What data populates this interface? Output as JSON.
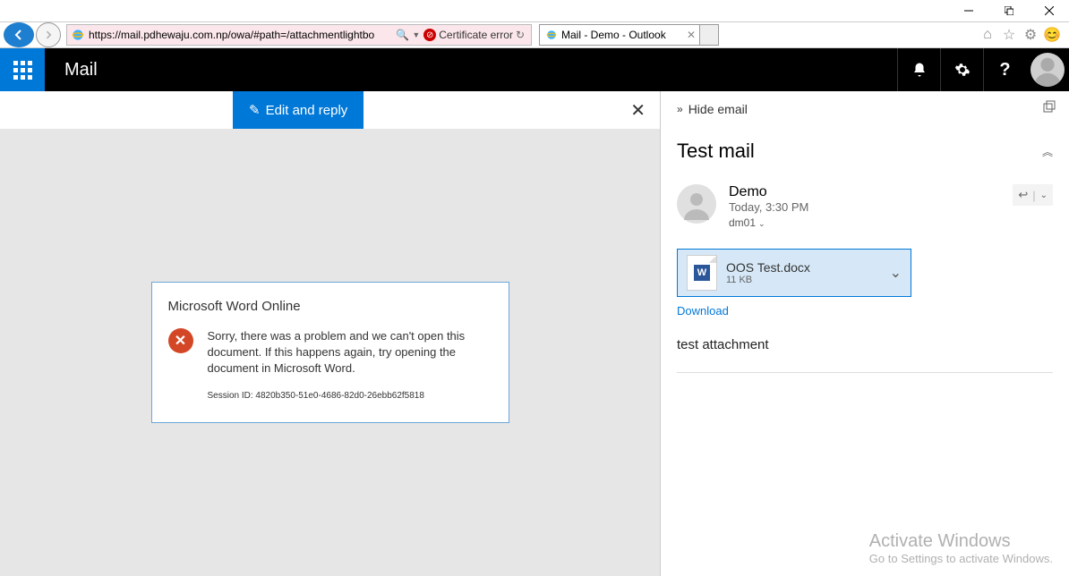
{
  "window": {
    "url": "https://mail.pdhewaju.com.np/owa/#path=/attachmentlightbo",
    "cert_label": "Certificate error",
    "tab_title": "Mail - Demo - Outlook"
  },
  "header": {
    "title": "Mail"
  },
  "left": {
    "edit_reply": "Edit and reply",
    "error_app": "Microsoft Word Online",
    "error_msg": "Sorry, there was a problem and we can't open this document.  If this happens again, try opening the document in Microsoft Word.",
    "session_prefix": "Session ID: ",
    "session_id": "4820b350-51e0-4686-82d0-26ebb62f5818"
  },
  "right": {
    "hide_email": "Hide email",
    "subject": "Test mail",
    "sender_name": "Demo",
    "sender_time": "Today, 3:30 PM",
    "sender_to": "dm01",
    "attachment_name": "OOS Test.docx",
    "attachment_size": "11 KB",
    "download": "Download",
    "body": "test attachment"
  },
  "watermark": {
    "line1": "Activate Windows",
    "line2": "Go to Settings to activate Windows."
  }
}
